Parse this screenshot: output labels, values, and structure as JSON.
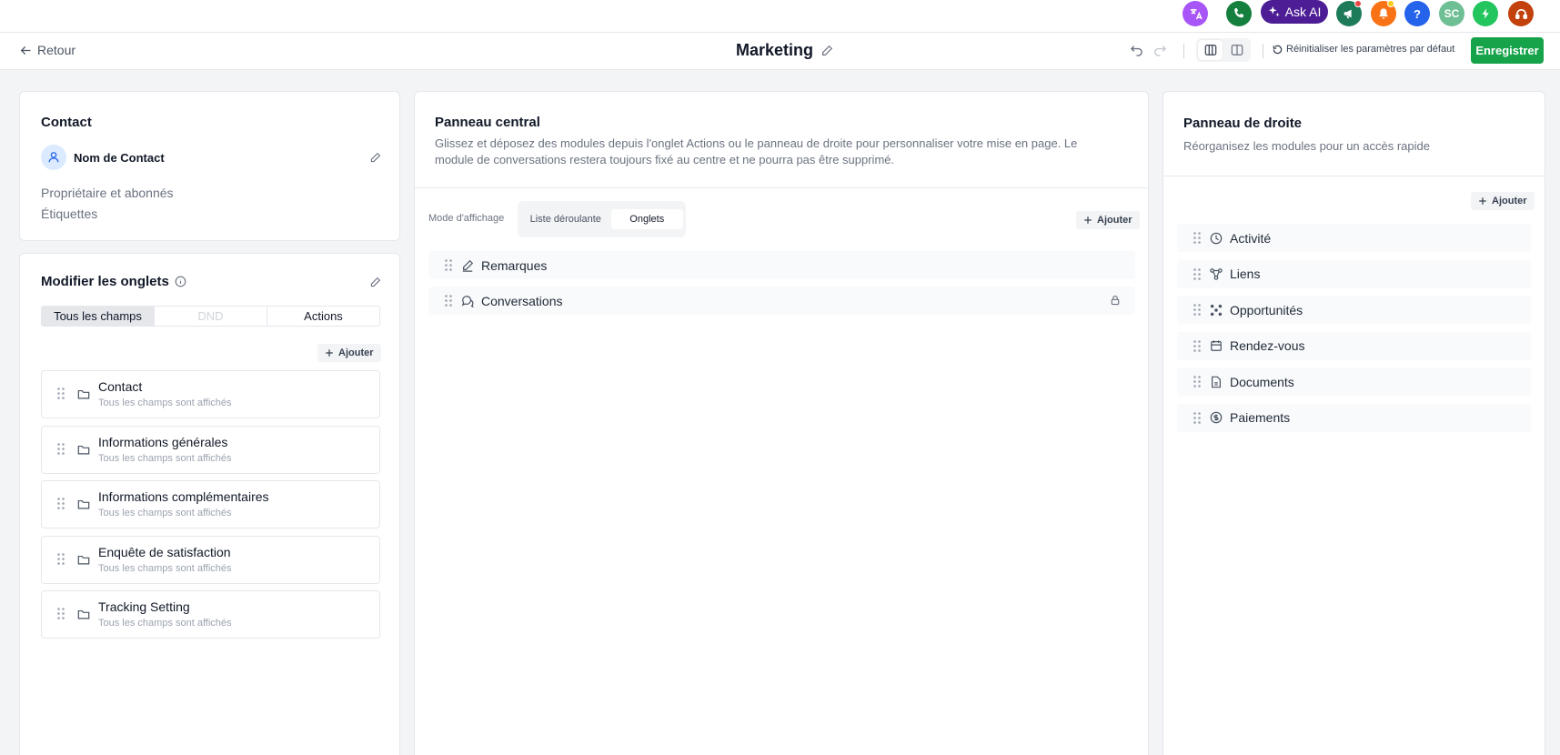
{
  "topbar": {
    "translate_icon_color": "#a855f7",
    "ask_ai_label": "Ask AI",
    "avatar_initials": "SC"
  },
  "header": {
    "back_label": "Retour",
    "title": "Marketing",
    "reset_label": "Réinitialiser les paramètres par défaut",
    "save_label": "Enregistrer"
  },
  "contact_card": {
    "title": "Contact",
    "name": "Nom de Contact",
    "owner_label": "Propriétaire et abonnés",
    "tags_label": "Étiquettes"
  },
  "tabs_editor": {
    "title": "Modifier les onglets",
    "tabs": [
      "Tous les champs",
      "DND",
      "Actions"
    ],
    "add_label": "Ajouter",
    "sections": [
      {
        "name": "Contact",
        "sub": "Tous les champs sont affichés"
      },
      {
        "name": "Informations générales",
        "sub": "Tous les champs sont affichés"
      },
      {
        "name": "Informations complémentaires",
        "sub": "Tous les champs sont affichés"
      },
      {
        "name": "Enquête de satisfaction",
        "sub": "Tous les champs sont affichés"
      },
      {
        "name": "Tracking Setting",
        "sub": "Tous les champs sont affichés"
      }
    ]
  },
  "central": {
    "title": "Panneau central",
    "description": "Glissez et déposez des modules depuis l'onglet Actions ou le panneau de droite pour personnaliser votre mise en page. Le module de conversations restera toujours fixé au centre et ne pourra pas être supprimé.",
    "mode_label": "Mode d'affichage",
    "mode_options": [
      "Liste déroulante",
      "Onglets"
    ],
    "add_label": "Ajouter",
    "modules": [
      "Remarques",
      "Conversations"
    ]
  },
  "right": {
    "title": "Panneau de droite",
    "description": "Réorganisez les modules pour un accès rapide",
    "add_label": "Ajouter",
    "modules": [
      "Activité",
      "Liens",
      "Opportunités",
      "Rendez-vous",
      "Documents",
      "Paiements"
    ]
  }
}
